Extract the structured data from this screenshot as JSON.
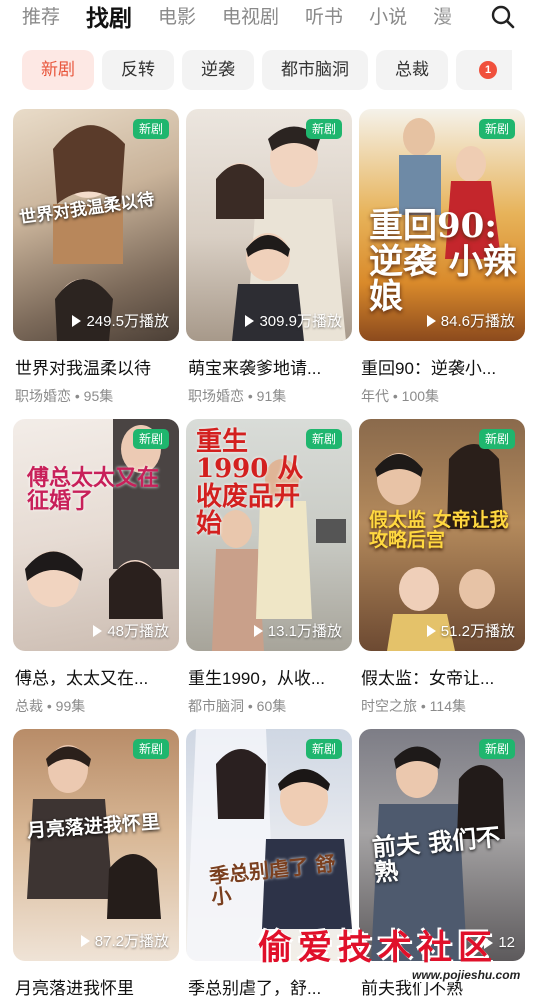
{
  "top_tabs": [
    {
      "label": "推荐",
      "active": false
    },
    {
      "label": "找剧",
      "active": true
    },
    {
      "label": "电影",
      "active": false
    },
    {
      "label": "电视剧",
      "active": false
    },
    {
      "label": "听书",
      "active": false
    },
    {
      "label": "小说",
      "active": false
    },
    {
      "label": "漫",
      "active": false
    }
  ],
  "search_icon": "search-icon",
  "filter_chips": [
    {
      "label": "新剧",
      "active": true
    },
    {
      "label": "反转",
      "active": false
    },
    {
      "label": "逆袭",
      "active": false
    },
    {
      "label": "都市脑洞",
      "active": false
    },
    {
      "label": "总裁",
      "active": false
    }
  ],
  "filter_more_badge": "1",
  "dramas": [
    {
      "title": "世界对我温柔以待",
      "meta": "职场婚恋 • 95集",
      "plays": "249.5万播放",
      "badge": "新剧",
      "poster_text": "世界对我温柔以待"
    },
    {
      "title": "萌宝来袭爹地请...",
      "meta": "职场婚恋 • 91集",
      "plays": "309.9万播放",
      "badge": "新剧",
      "poster_text": ""
    },
    {
      "title": "重回90：逆袭小...",
      "meta": "年代 • 100集",
      "plays": "84.6万播放",
      "badge": "新剧",
      "poster_text": "重回90: 逆袭 小辣娘"
    },
    {
      "title": "傅总，太太又在...",
      "meta": "总裁 • 99集",
      "plays": "48万播放",
      "badge": "新剧",
      "poster_text": "傅总太太又在征婚了"
    },
    {
      "title": "重生1990，从收...",
      "meta": "都市脑洞 • 60集",
      "plays": "13.1万播放",
      "badge": "新剧",
      "poster_text": "重生1990 从收废品开始"
    },
    {
      "title": "假太监：女帝让...",
      "meta": "时空之旅 • 114集",
      "plays": "51.2万播放",
      "badge": "新剧",
      "poster_text": "假太监 女帝让我 攻略后宫"
    },
    {
      "title": "月亮落进我怀里",
      "meta": "",
      "plays": "87.2万播放",
      "badge": "新剧",
      "poster_text": "月亮落进我怀里"
    },
    {
      "title": "季总别虐了，舒...",
      "meta": "",
      "plays": "",
      "badge": "新剧",
      "poster_text": "季总别虐了 舒小"
    },
    {
      "title": "前夫我们不熟",
      "meta": "",
      "plays": "12",
      "badge": "新剧",
      "poster_text": "前夫 我们不熟"
    }
  ],
  "watermark": {
    "text": "偷爱技术社区",
    "url": "www.pojieshu.com"
  }
}
